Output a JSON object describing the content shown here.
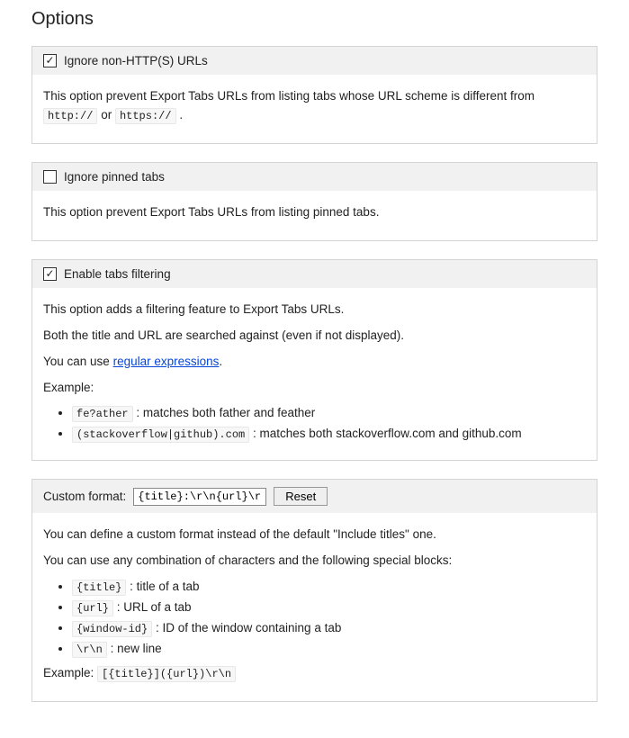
{
  "page": {
    "title": "Options"
  },
  "ignoreHttp": {
    "label": "Ignore non-HTTP(S) URLs",
    "checked": true,
    "desc_pre": "This option prevent Export Tabs URLs from listing tabs whose URL scheme is different from ",
    "code1": "http://",
    "or": " or ",
    "code2": "https://",
    "period": " ."
  },
  "ignorePinned": {
    "label": "Ignore pinned tabs",
    "checked": false,
    "desc": "This option prevent Export Tabs URLs from listing pinned tabs."
  },
  "filtering": {
    "label": "Enable tabs filtering",
    "checked": true,
    "desc1": "This option adds a filtering feature to Export Tabs URLs.",
    "desc2": "Both the title and URL are searched against (even if not displayed).",
    "desc3_pre": "You can use ",
    "regex_link": "regular expressions",
    "desc3_post": ".",
    "example_label": "Example:",
    "ex1_code": "fe?ather",
    "ex1_text": " : matches both father and feather",
    "ex2_code": "(stackoverflow|github).com",
    "ex2_text": " : matches both stackoverflow.com and github.com"
  },
  "customFormat": {
    "label": "Custom format:",
    "value": "{title}:\\r\\n{url}\\r\\n\\r\\n",
    "reset": "Reset",
    "desc1": "You can define a custom format instead of the default \"Include titles\" one.",
    "desc2": "You can use any combination of characters and the following special blocks:",
    "b1_code": "{title}",
    "b1_text": " : title of a tab",
    "b2_code": "{url}",
    "b2_text": " : URL of a tab",
    "b3_code": "{window-id}",
    "b3_text": " : ID of the window containing a tab",
    "b4_code": "\\r\\n",
    "b4_text": " : new line",
    "example_label": "Example: ",
    "example_code": "[{title}]({url})\\r\\n"
  }
}
